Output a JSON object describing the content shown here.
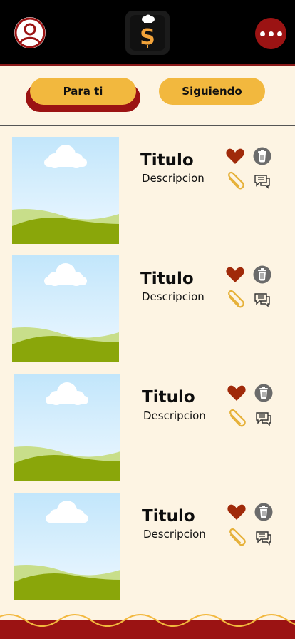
{
  "header": {
    "avatar_icon": "user-circle-icon",
    "logo_icon": "chef-s-logo",
    "menu_icon": "more-horizontal-icon"
  },
  "tabs": [
    {
      "label": "Para ti",
      "active": true
    },
    {
      "label": "Siguiendo",
      "active": false
    }
  ],
  "posts": [
    {
      "title": "Titulo",
      "description": "Descripcion"
    },
    {
      "title": "Titulo",
      "description": "Descripcion"
    },
    {
      "title": "Titulo",
      "description": "Descripcion"
    },
    {
      "title": "Titulo",
      "description": "Descripcion"
    }
  ],
  "colors": {
    "header_bg": "#000000",
    "accent_red": "#9b1313",
    "tab_yellow": "#f2b83e",
    "page_bg": "#fdf4e3",
    "heart": "#a02a0a",
    "clip": "#e6b13a",
    "trash": "#6b6b6b"
  }
}
